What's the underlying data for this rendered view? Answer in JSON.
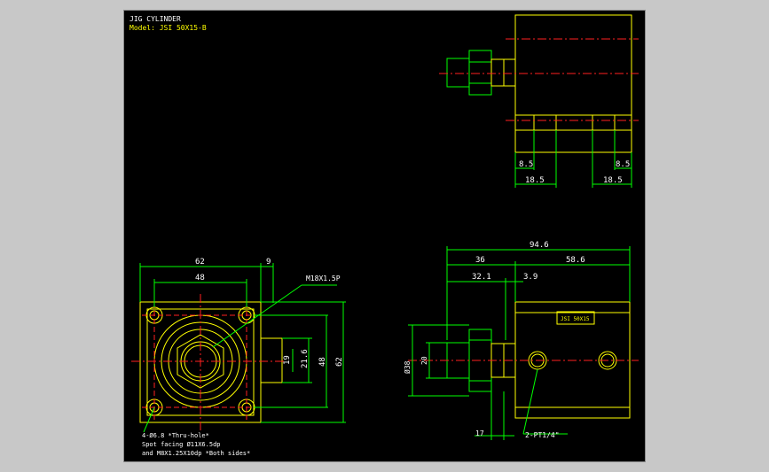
{
  "title": {
    "line1": "JIG CYLINDER",
    "line2": "Model: JSI 50X15-B"
  },
  "colors": {
    "background": "#000000",
    "outline": "#ffff00",
    "dimension": "#00ff00",
    "centerline": "#ff2020",
    "annotation": "#ffffff",
    "hidden": "#00ffff"
  },
  "dimensions": {
    "d8_5_left": "8.5",
    "d8_5_right": "8.5",
    "d18_5_left": "18.5",
    "d18_5_right": "18.5",
    "d62_top": "62",
    "d9": "9",
    "d48_top": "48",
    "d19": "19",
    "d21_6": "21.6",
    "d48_side": "48",
    "d62_side": "62",
    "d94_6": "94.6",
    "d36": "36",
    "d58_6": "58.6",
    "d32_1": "32.1",
    "d3_9": "3.9",
    "d20": "20",
    "d38": "Ø38",
    "d17": "17"
  },
  "annotations": {
    "thread": "M18X1.5P",
    "holes": "4-Ø6.8 *Thru-hole*",
    "spot": "Spot facing Ø11X6.5dp",
    "tap": "and M8X1.25X10dp *Both sides*",
    "ports": "2-PT1/4\"",
    "nameplate": "JSI 50X15"
  }
}
